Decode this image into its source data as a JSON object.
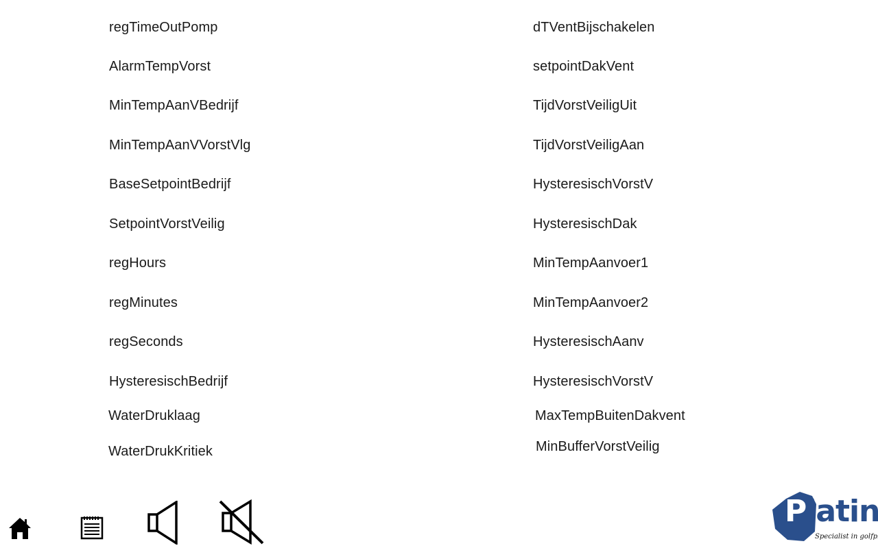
{
  "parameters": {
    "left": [
      "regTimeOutPomp",
      "AlarmTempVorst",
      "MinTempAanVBedrijf",
      "MinTempAanVVorstVlg",
      "BaseSetpointBedrijf",
      "SetpointVorstVeilig",
      "regHours",
      "regMinutes",
      "regSeconds",
      "HysteresischBedrijf",
      "WaterDruklaag",
      "WaterDrukKritiek"
    ],
    "right": [
      "dTVentBijschakelen",
      "setpointDakVent",
      "TijdVorstVeiligUit",
      "TijdVorstVeiligAan",
      "HysteresischVorstV",
      "HysteresischDak",
      "MinTempAanvoer1",
      "MinTempAanvoer2",
      "HysteresischAanv",
      "HysteresischVorstV",
      "MaxTempBuitenDakvent",
      "MinBufferVorstVeilig"
    ]
  },
  "toolbar": {
    "icons": [
      "home-icon",
      "notepad-icon",
      "speaker-icon",
      "speaker-mute-icon"
    ]
  },
  "logo": {
    "brand": "Platina",
    "tagline": "Specialist in golfplaten",
    "color": "#2a4f8c"
  }
}
